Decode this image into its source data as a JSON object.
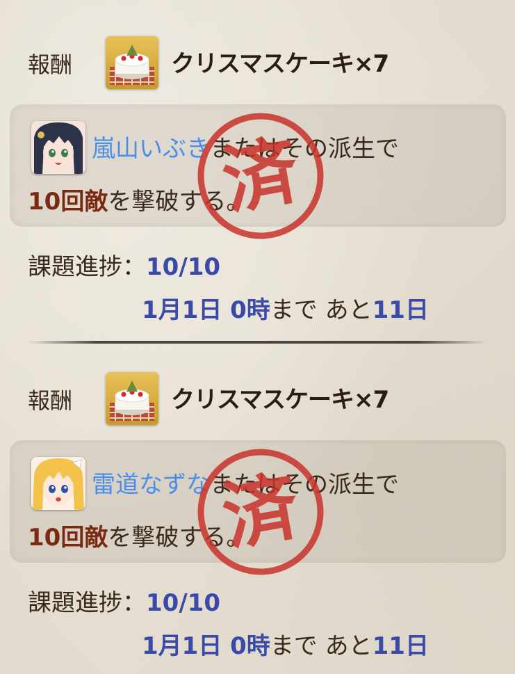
{
  "missions": [
    {
      "reward_label": "報酬",
      "reward_item": "クリスマスケーキ×7",
      "character_name": "嵐山いぶき",
      "condition_suffix": "またはその派生で",
      "defeat_count": "10回敵",
      "condition_end": "を撃破する。",
      "progress_label": "課題進捗：",
      "progress_value": "10/10",
      "deadline_date": "1月1日 0時",
      "deadline_until": "まで あと",
      "remaining": "11日",
      "stamp_text": "済",
      "avatar_icon": "dark-haired-girl-avatar-icon",
      "completed": true
    },
    {
      "reward_label": "報酬",
      "reward_item": "クリスマスケーキ×7",
      "character_name": "雷道なずな",
      "condition_suffix": "またはその派生で",
      "defeat_count": "10回敵",
      "condition_end": "を撃破する。",
      "progress_label": "課題進捗：",
      "progress_value": "10/10",
      "deadline_date": "1月1日 0時",
      "deadline_until": "まで あと",
      "remaining": "11日",
      "stamp_text": "済",
      "avatar_icon": "blonde-girl-avatar-icon",
      "completed": true
    }
  ],
  "colors": {
    "character_name": "#4a8ee8",
    "count": "#7b2a12",
    "progress": "#3a4aa8",
    "stamp": "#c8322a"
  }
}
